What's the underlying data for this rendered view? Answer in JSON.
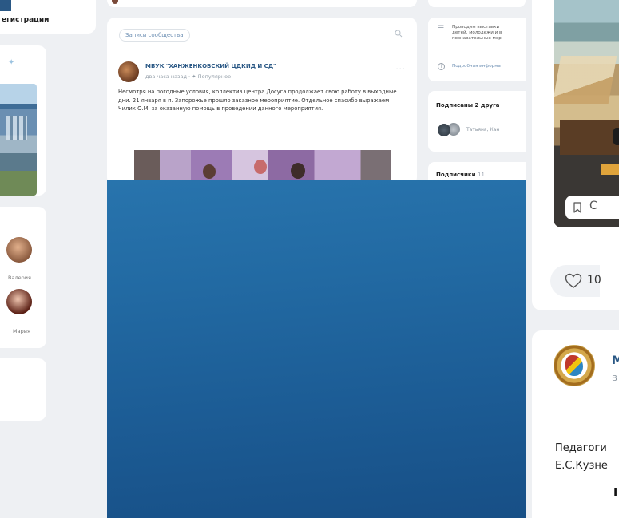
{
  "left": {
    "registration_label": "егистрации",
    "people": [
      {
        "name": "Валерия",
        "color": "#b08060"
      },
      {
        "name": "Мария",
        "color": "#7a3a2a"
      }
    ]
  },
  "post": {
    "search_label": "Записи сообщества",
    "author": "МБУК \"ХАНЖЕНКОВСКИЙ ЦДКИД И СД\"",
    "meta": "два часа назад · ✦ Популярное",
    "text": "Несмотря на погодные условия, коллектив центра Досуга продолжает свою работу в выходные дни. 21 января в п. Запорожье прошло заказное мероприятие. Отдельное спасибо выражаем Чилик О.М. за оказанную помощь в проведении данного мероприятия.",
    "more": "···"
  },
  "right": {
    "info_lines": [
      "Проводим выставки",
      "детей, молодежи и в",
      "познавательных мер"
    ],
    "info_link": "Подробная информа",
    "friends_title": "Подписаны 2 друга",
    "friend_name": "Татьяна, Кан",
    "subscribers_title": "Подписчики",
    "subscribers_count": "11"
  },
  "far_right": {
    "like_count": "10",
    "more_glyph": "C",
    "author_initial": "M",
    "sub_initial": "В",
    "text_line1": "Педагоги",
    "text_line2": "Е.С.Кузне",
    "bottom_glyph": "I"
  }
}
